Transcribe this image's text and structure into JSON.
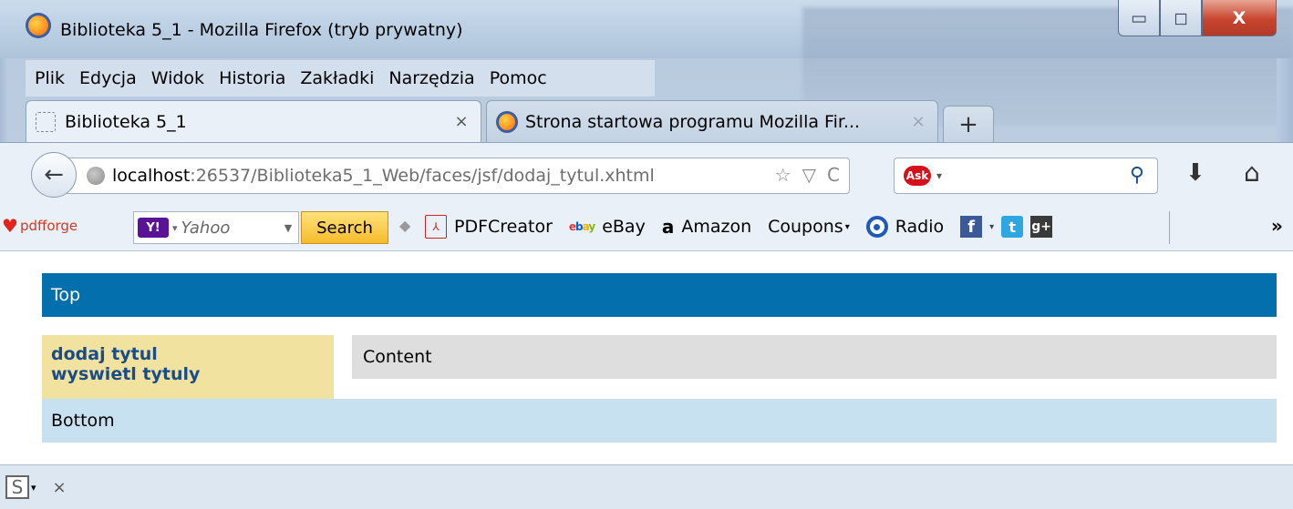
{
  "window": {
    "title": "Biblioteka 5_1 - Mozilla Firefox (tryb prywatny)",
    "min_glyph": "▭",
    "max_glyph": "◻",
    "close_glyph": "X"
  },
  "menu": {
    "items": [
      "Plik",
      "Edycja",
      "Widok",
      "Historia",
      "Zakładki",
      "Narzędzia",
      "Pomoc"
    ]
  },
  "tabs": [
    {
      "label": "Biblioteka 5_1",
      "active": true,
      "close": "×"
    },
    {
      "label": "Strona startowa programu Mozilla Fir...",
      "active": false,
      "close": "×"
    }
  ],
  "new_tab_label": "+",
  "nav": {
    "back_glyph": "←",
    "url_host": "localhost",
    "url_rest": ":26537/Biblioteka5_1_Web/faces/jsf/dodaj_tytul.xhtml",
    "star_glyph": "☆",
    "dropdown_glyph": "▽",
    "reload_glyph": "C",
    "search_engine": "Ask",
    "search_caret": "▾",
    "magnifier_glyph": "⚲",
    "download_glyph": "⬇",
    "home_glyph": "⌂"
  },
  "bookmarks": {
    "pdfforge_label": "pdfforge",
    "yahoo_logo": "Y!",
    "yahoo_caret": "▾",
    "yahoo_placeholder": "Yahoo",
    "yahoo_dropdown": "▼",
    "search_button": "Search",
    "separator": "◆",
    "items": {
      "pdfcreator": "PDFCreator",
      "ebay": "eBay",
      "amazon_glyph": "a",
      "amazon": "Amazon",
      "coupons": "Coupons",
      "coupons_caret": "▾",
      "radio": "Radio",
      "fb_glyph": "f",
      "caret": "▾",
      "tw_glyph": "t",
      "gplus_glyph": "g+"
    },
    "more_glyph": "»"
  },
  "page": {
    "top": "Top",
    "links": [
      "dodaj tytul",
      "wyswietl tytuly"
    ],
    "content": "Content",
    "bottom": "Bottom"
  },
  "addon_bar": {
    "s_glyph": "S",
    "caret": "▾",
    "close": "×"
  },
  "colors": {
    "top_bg": "#036fad",
    "left_bg": "#f2e2a0",
    "content_bg": "#dedede",
    "bottom_bg": "#c8e1f0",
    "link": "#1a4c86"
  }
}
